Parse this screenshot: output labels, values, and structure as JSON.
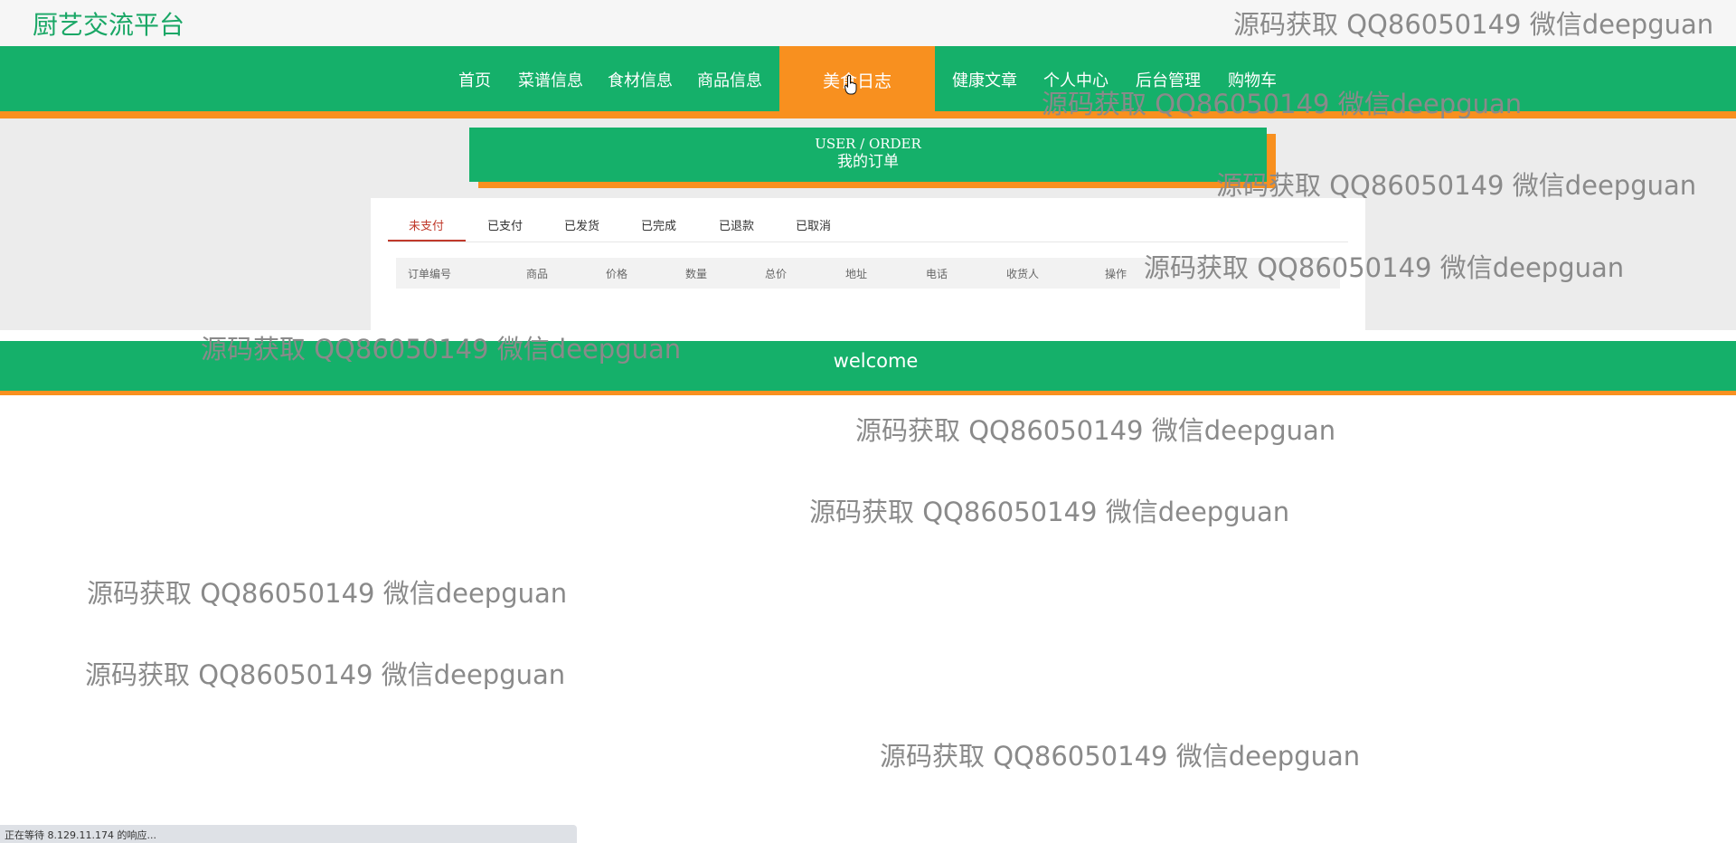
{
  "site": {
    "title": "厨艺交流平台"
  },
  "nav": {
    "items": [
      {
        "label": "首页"
      },
      {
        "label": "菜谱信息"
      },
      {
        "label": "食材信息"
      },
      {
        "label": "商品信息"
      },
      {
        "label": "美食日志"
      },
      {
        "label": "健康文章"
      },
      {
        "label": "个人中心"
      },
      {
        "label": "后台管理"
      },
      {
        "label": "购物车"
      }
    ],
    "active_label": "美食日志"
  },
  "order_header": {
    "en": "USER / ORDER",
    "cn": "我的订单"
  },
  "tabs": [
    {
      "label": "未支付",
      "active": true
    },
    {
      "label": "已支付"
    },
    {
      "label": "已发货"
    },
    {
      "label": "已完成"
    },
    {
      "label": "已退款"
    },
    {
      "label": "已取消"
    }
  ],
  "table": {
    "columns": [
      "订单编号",
      "商品",
      "价格",
      "数量",
      "总价",
      "地址",
      "电话",
      "收货人",
      "操作"
    ]
  },
  "footer": {
    "welcome": "welcome"
  },
  "watermark": {
    "text": "源码获取 QQ86050149 微信deepguan"
  },
  "status": {
    "text": "正在等待 8.129.11.174 的响应..."
  },
  "colors": {
    "green": "#15b06a",
    "orange": "#f8901f",
    "title_green": "#1aa766",
    "active_tab_red": "#c0392b"
  }
}
